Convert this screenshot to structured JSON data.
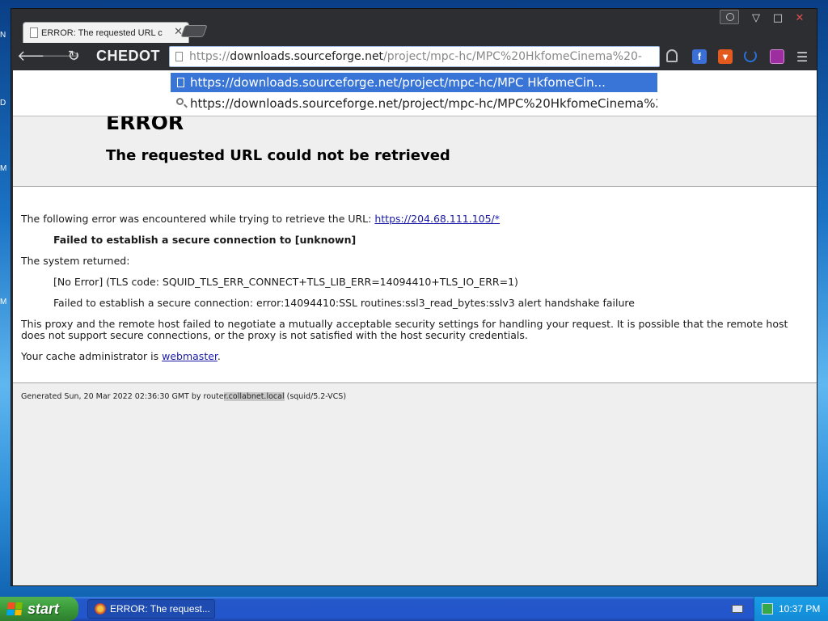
{
  "desktop": {
    "fragments": [
      "N",
      "D",
      "M",
      "M"
    ]
  },
  "browser": {
    "tab": {
      "title": "ERROR: The requested URL c",
      "close_glyph": "✕"
    },
    "window_controls": {
      "minimize": "▽",
      "maximize": "□",
      "close": "✕"
    },
    "nav": {
      "back": "🡐",
      "forward": "🡒",
      "reload": "↻"
    },
    "brand": "CHEDOT",
    "omnibox": {
      "prefix": "https://",
      "host": "downloads.sourceforge.net",
      "path": "/project/mpc-hc/MPC%20HkfomeCinema%20-"
    },
    "extensions": [
      "lock-icon",
      "facebook-icon",
      "video-icon",
      "loading-icon",
      "monitor-icon",
      "menu-icon"
    ],
    "menu_glyph": "☰"
  },
  "autocomplete": {
    "selected": "https://downloads.sourceforge.net/project/mpc-hc/MPC HkfomeCin...",
    "alternate": "https://downloads.sourceforge.net/project/mpc-hc/MPC%20HkfomeCinema%2..."
  },
  "page": {
    "title": "ERROR",
    "subtitle": "The requested URL could not be retrieved",
    "intro": "The following error was encountered while trying to retrieve the URL: ",
    "url_link": "https://204.68.111.105/*",
    "error_bold": "Failed to establish a secure connection to [unknown]",
    "system_returned": "The system returned:",
    "tls_code": "[No Error] (TLS code: SQUID_TLS_ERR_CONNECT+TLS_LIB_ERR=14094410+TLS_IO_ERR=1)",
    "ssl_error": "Failed to establish a secure connection: error:14094410:SSL routines:ssl3_read_bytes:sslv3 alert handshake failure",
    "explanation": "This proxy and the remote host failed to negotiate a mutually acceptable security settings for handling your request. It is possible that the remote host does not support secure connections, or the proxy is not satisfied with the host security credentials.",
    "admin_prefix": "Your cache administrator is ",
    "admin_link": "webmaster",
    "admin_suffix": ".",
    "footer_prefix": "Generated Sun, 20 Mar 2022 02:36:30 GMT by route",
    "footer_highlight": "r.collabnet.local",
    "footer_suffix": " (squid/5.2-VCS)"
  },
  "taskbar": {
    "start_label": "start",
    "task_label": "ERROR: The request...",
    "clock": "10:37 PM"
  }
}
